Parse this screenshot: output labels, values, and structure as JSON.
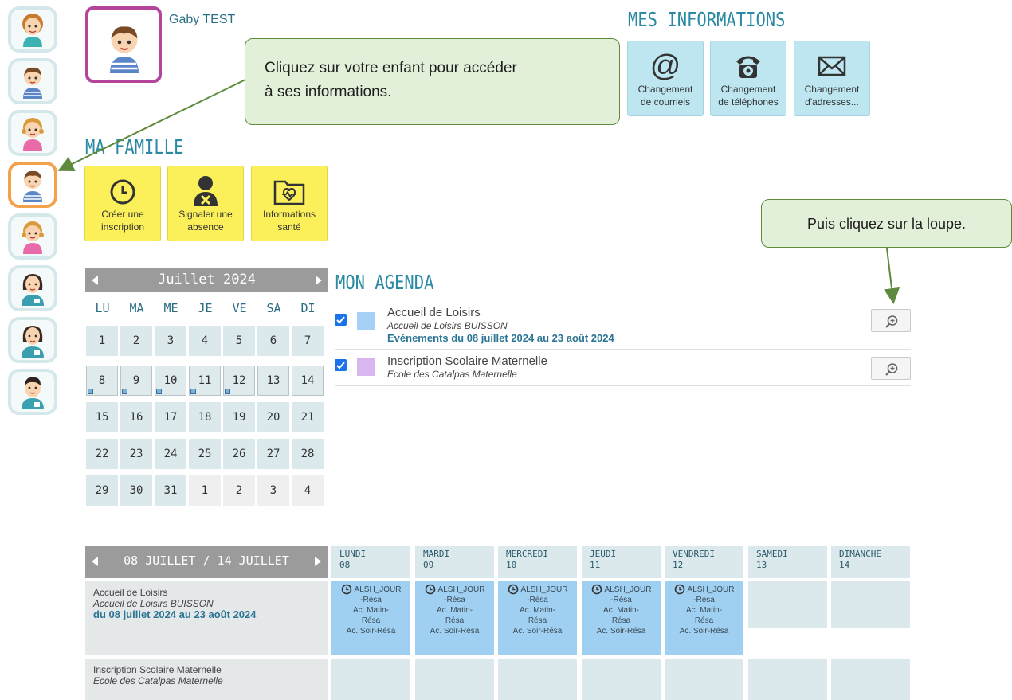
{
  "child": {
    "name": "Gaby TEST"
  },
  "sections": {
    "mes_informations": "MES INFORMATIONS",
    "ma_famille": "MA FAMILLE",
    "mon_agenda": "MON AGENDA"
  },
  "info_buttons": [
    {
      "line1": "Changement",
      "line2": "de courriels",
      "icon": "at-icon"
    },
    {
      "line1": "Changement",
      "line2": "de téléphones",
      "icon": "phone-icon"
    },
    {
      "line1": "Changement",
      "line2": "d'adresses...",
      "icon": "envelope-icon"
    }
  ],
  "family_buttons": [
    {
      "line1": "Créer une",
      "line2": "inscription",
      "icon": "clock-icon"
    },
    {
      "line1": "Signaler une",
      "line2": "absence",
      "icon": "person-x-icon"
    },
    {
      "line1": "Informations",
      "line2": "santé",
      "icon": "health-folder-icon"
    }
  ],
  "callouts": {
    "child": {
      "line1": "Cliquez sur votre enfant pour accéder",
      "line2": "à ses informations."
    },
    "zoom": "Puis cliquez sur la loupe."
  },
  "month_calendar": {
    "title": "Juillet 2024",
    "weekdays": [
      "LU",
      "MA",
      "ME",
      "JE",
      "VE",
      "SA",
      "DI"
    ],
    "weeks": [
      [
        "1",
        "2",
        "3",
        "4",
        "5",
        "6",
        "7"
      ],
      [
        "8",
        "9",
        "10",
        "11",
        "12",
        "13",
        "14"
      ],
      [
        "15",
        "16",
        "17",
        "18",
        "19",
        "20",
        "21"
      ],
      [
        "22",
        "23",
        "24",
        "25",
        "26",
        "27",
        "28"
      ],
      [
        "29",
        "30",
        "31",
        "1",
        "2",
        "3",
        "4"
      ]
    ]
  },
  "agenda": [
    {
      "title": "Accueil de Loisirs",
      "subtitle": "Accueil de Loisirs BUISSON",
      "period": "Evénements du 08 juillet 2024 au 23 août 2024",
      "color": "#a6d0f5"
    },
    {
      "title": "Inscription Scolaire Maternelle",
      "subtitle": "Ecole des Catalpas Maternelle",
      "period": "",
      "color": "#d9b6f0"
    }
  ],
  "week": {
    "title": "08 JUILLET / 14 JUILLET",
    "days": [
      {
        "name": "LUNDI",
        "num": "08"
      },
      {
        "name": "MARDI",
        "num": "09"
      },
      {
        "name": "MERCREDI",
        "num": "10"
      },
      {
        "name": "JEUDI",
        "num": "11"
      },
      {
        "name": "VENDREDI",
        "num": "12"
      },
      {
        "name": "SAMEDI",
        "num": "13"
      },
      {
        "name": "DIMANCHE",
        "num": "14"
      }
    ],
    "rows": [
      {
        "title": "Accueil de Loisirs",
        "subtitle": "Accueil de Loisirs BUISSON",
        "period": "du 08 juillet 2024 au 23 août 2024"
      },
      {
        "title": "Inscription Scolaire Maternelle",
        "subtitle": "Ecole des Catalpas Maternelle"
      }
    ],
    "event": {
      "code": "ALSH_JOUR",
      "l1": "-Résa",
      "l2": "Ac. Matin-",
      "l3": "Résa",
      "l4": "Ac. Soir-Résa"
    }
  },
  "colors": {
    "accent": "#2a8aa4",
    "info_btn": "#bde6f1",
    "family_btn": "#fbef5a",
    "selected_child": "#f3a24c",
    "event": "#9fd0f2"
  }
}
